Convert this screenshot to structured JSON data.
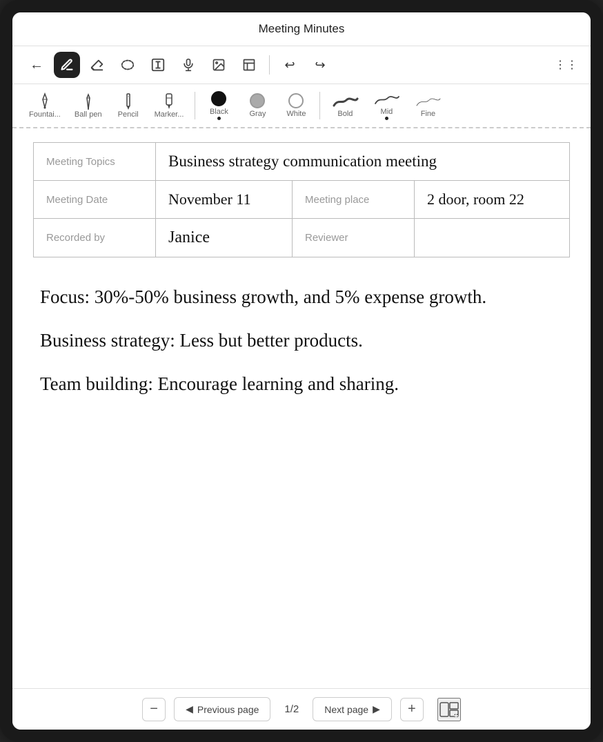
{
  "app": {
    "title": "Meeting Minutes"
  },
  "toolbar_main": {
    "back_label": "←",
    "tools": [
      {
        "name": "pen-tool",
        "icon": "✏️",
        "active": true
      },
      {
        "name": "eraser-tool",
        "icon": "⬡"
      },
      {
        "name": "lasso-tool",
        "icon": "⬭"
      },
      {
        "name": "text-tool",
        "icon": "T"
      },
      {
        "name": "audio-tool",
        "icon": "🎤"
      },
      {
        "name": "image-tool",
        "icon": "🖼"
      },
      {
        "name": "template-tool",
        "icon": "⊞"
      }
    ],
    "undo_label": "↩",
    "redo_label": "↪",
    "more_label": "⋮⋮"
  },
  "toolbar_secondary": {
    "pen_types": [
      {
        "name": "fountain-pen",
        "label": "Fountai..."
      },
      {
        "name": "ball-pen",
        "label": "Ball pen"
      },
      {
        "name": "pencil",
        "label": "Pencil"
      },
      {
        "name": "marker",
        "label": "Marker..."
      }
    ],
    "colors": [
      {
        "name": "black",
        "label": "Black",
        "value": "#000",
        "selected": true
      },
      {
        "name": "gray",
        "label": "Gray",
        "value": "#aaa"
      },
      {
        "name": "white",
        "label": "White",
        "value": "#fff"
      }
    ],
    "weights": [
      {
        "name": "bold",
        "label": "Bold"
      },
      {
        "name": "mid",
        "label": "Mid"
      },
      {
        "name": "fine",
        "label": "Fine"
      }
    ]
  },
  "table": {
    "rows": [
      {
        "col1_label": "Meeting Topics",
        "col1_value": "Business strategy communication meeting",
        "col2_label": null,
        "col2_value": null,
        "span": true
      },
      {
        "col1_label": "Meeting Date",
        "col1_value": "November 11",
        "col2_label": "Meeting place",
        "col2_value": "2 door, room 22"
      },
      {
        "col1_label": "Recorded by",
        "col1_value": "Janice",
        "col2_label": "Reviewer",
        "col2_value": ""
      }
    ]
  },
  "notes": {
    "lines": [
      "Focus: 30%-50% business growth, and 5% expense growth.",
      "Business strategy: Less but better products.",
      "Team building: Encourage learning and sharing."
    ]
  },
  "bottom_bar": {
    "minus_label": "−",
    "prev_label": "◀  Previous page",
    "page_indicator": "1/2",
    "next_label": "Next page  ▶",
    "add_label": "+",
    "layout_icon": "⊞"
  }
}
